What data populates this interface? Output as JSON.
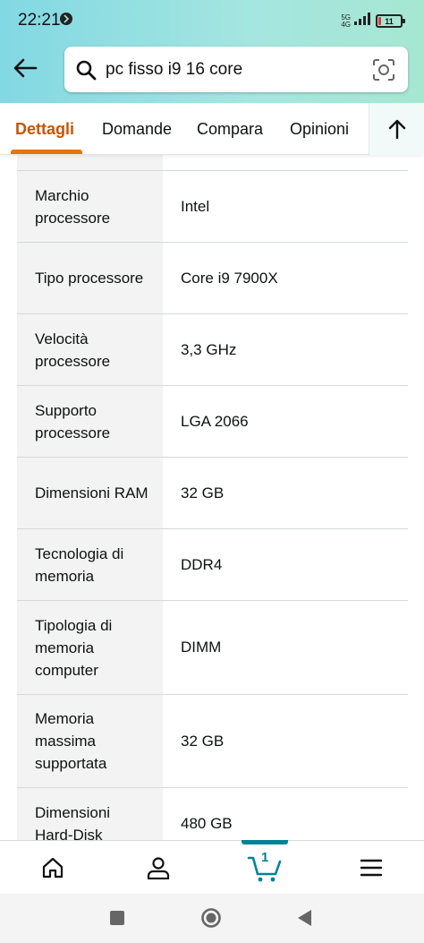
{
  "status_bar": {
    "time": "22:21",
    "network_top": "5G",
    "network_bottom": "4G",
    "battery": "11",
    "battery_fraction": 0.11
  },
  "search": {
    "query": "pc fisso i9 16 core"
  },
  "tabs": [
    {
      "label": "Dettagli",
      "active": true
    },
    {
      "label": "Domande",
      "active": false
    },
    {
      "label": "Compara",
      "active": false
    },
    {
      "label": "Opinioni",
      "active": false
    }
  ],
  "specs": [
    {
      "label": "",
      "value": ""
    },
    {
      "label": "Marchio processore",
      "value": "Intel"
    },
    {
      "label": "Tipo processore",
      "value": "Core i9 7900X"
    },
    {
      "label": "Velocità processore",
      "value": "3,3 GHz"
    },
    {
      "label": "Supporto processore",
      "value": "LGA 2066"
    },
    {
      "label": "Dimensioni RAM",
      "value": "32 GB"
    },
    {
      "label": "Tecnologia di memoria",
      "value": "DDR4"
    },
    {
      "label": "Tipologia di memoria computer",
      "value": "DIMM"
    },
    {
      "label": "Memoria massima supportata",
      "value": "32 GB"
    },
    {
      "label": "Dimensioni Hard-Disk",
      "value": "480 GB"
    }
  ],
  "bottom_nav": {
    "items": [
      "home-icon",
      "account-icon",
      "cart-icon",
      "menu-icon"
    ],
    "cart_count": "1",
    "accent_color": "#008296"
  },
  "colors": {
    "active_tab": "#c45500",
    "tab_underline": "#e77600",
    "label_background": "#f3f3f3"
  }
}
